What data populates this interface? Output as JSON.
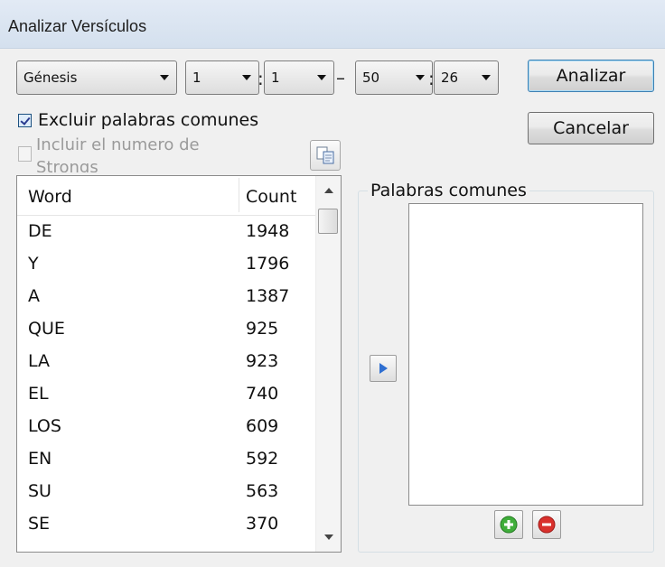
{
  "window": {
    "title": "Analizar Versículos"
  },
  "range": {
    "book": "Génesis",
    "from_chapter": "1",
    "from_verse": "1",
    "dash": "–",
    "colon": ":",
    "to_chapter": "50",
    "to_verse": "26"
  },
  "buttons": {
    "analyze": "Analizar",
    "cancel": "Cancelar"
  },
  "options": {
    "exclude_common": {
      "label": "Excluir palabras comunes",
      "checked": true
    },
    "include_strongs": {
      "label": "Incluir el numero de Strongs",
      "checked": false,
      "enabled": false
    }
  },
  "word_list": {
    "columns": [
      "Word",
      "Count"
    ],
    "rows": [
      {
        "word": "DE",
        "count": "1948"
      },
      {
        "word": "Y",
        "count": "1796"
      },
      {
        "word": "A",
        "count": "1387"
      },
      {
        "word": "QUE",
        "count": "925"
      },
      {
        "word": "LA",
        "count": "923"
      },
      {
        "word": "EL",
        "count": "740"
      },
      {
        "word": "LOS",
        "count": "609"
      },
      {
        "word": "EN",
        "count": "592"
      },
      {
        "word": "SU",
        "count": "563"
      },
      {
        "word": "SE",
        "count": "370"
      }
    ]
  },
  "common_words": {
    "title": "Palabras comunes",
    "items": []
  },
  "icons": {
    "copy": "copy-icon",
    "move": "arrow-right-icon",
    "add": "add-icon",
    "remove": "remove-icon",
    "combo_arrow": "chevron-down-icon",
    "scroll_up": "scroll-up-icon",
    "scroll_down": "scroll-down-icon"
  },
  "colors": {
    "title_bar": "#d9e4f1",
    "add_green": "#3fae3a",
    "remove_red": "#d9302c",
    "arrow_blue": "#2f6fd1",
    "check_blue": "#2a3b8f"
  }
}
